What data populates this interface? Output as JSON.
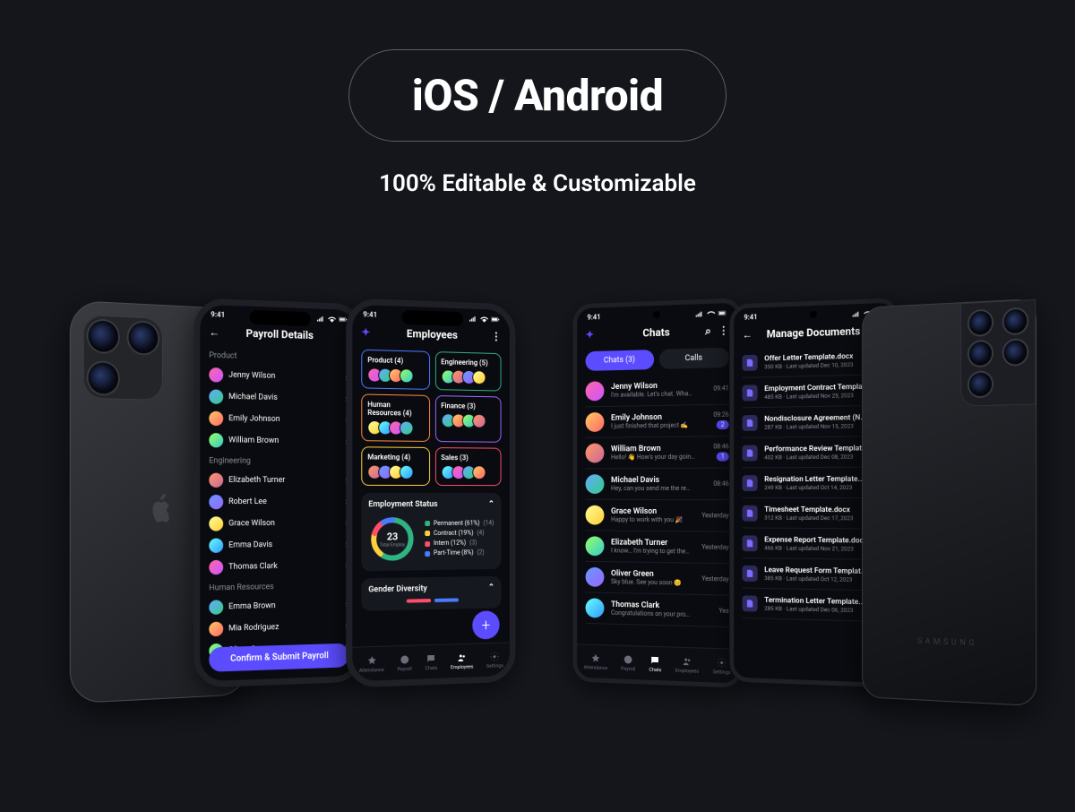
{
  "hero": {
    "title": "iOS / Android",
    "subtitle": "100% Editable & Customizable"
  },
  "status": {
    "time": "9:41"
  },
  "tabbar": [
    "Attendance",
    "Payroll",
    "Chats",
    "Employees",
    "Settings"
  ],
  "payroll": {
    "title": "Payroll Details",
    "groups": [
      {
        "name": "Product",
        "people": [
          {
            "n": "Jenny Wilson",
            "v": "$"
          },
          {
            "n": "Michael Davis",
            "v": "$"
          },
          {
            "n": "Emily Johnson",
            "v": "$"
          },
          {
            "n": "William Brown",
            "v": "$"
          }
        ]
      },
      {
        "name": "Engineering",
        "people": [
          {
            "n": "Elizabeth Turner",
            "v": "$"
          },
          {
            "n": "Robert Lee",
            "v": "$"
          },
          {
            "n": "Grace Wilson",
            "v": "$"
          },
          {
            "n": "Emma Davis",
            "v": "$"
          },
          {
            "n": "Thomas Clark",
            "v": "$"
          }
        ]
      },
      {
        "name": "Human Resources",
        "people": [
          {
            "n": "Emma Brown",
            "v": "$"
          },
          {
            "n": "Mia Rodriguez",
            "v": "$"
          },
          {
            "n": "Oliver Green",
            "v": "$"
          }
        ]
      }
    ],
    "cta": "Confirm & Submit Payroll"
  },
  "employees": {
    "title": "Employees",
    "depts": [
      {
        "n": "Product (4)",
        "c": "#4a7bff"
      },
      {
        "n": "Engineering (5)",
        "c": "#2fb380"
      },
      {
        "n": "Human Resources (4)",
        "c": "#ff8a3c"
      },
      {
        "n": "Finance (3)",
        "c": "#9b6bff"
      },
      {
        "n": "Marketing (4)",
        "c": "#ffcf3c"
      },
      {
        "n": "Sales (3)",
        "c": "#ff4d6a"
      }
    ],
    "status_panel": {
      "title": "Employment Status",
      "total": "23",
      "total_label": "Total Employ",
      "items": [
        {
          "l": "Permanent (61%)",
          "n": "(14)",
          "c": "#2fb380"
        },
        {
          "l": "Contract (19%)",
          "n": "(4)",
          "c": "#ffcf3c"
        },
        {
          "l": "Intern (12%)",
          "n": "(3)",
          "c": "#ff4d6a"
        },
        {
          "l": "Part-Time (8%)",
          "n": "(2)",
          "c": "#4a7bff"
        }
      ]
    },
    "diversity_panel": "Gender Diversity"
  },
  "chats": {
    "title": "Chats",
    "tabs": {
      "a": "Chats (3)",
      "b": "Calls"
    },
    "items": [
      {
        "n": "Jenny Wilson",
        "p": "I'm available. Let's chat. Wha…",
        "t": "09:41",
        "b": ""
      },
      {
        "n": "Emily Johnson",
        "p": "I just finished that project ✍️",
        "t": "09:26",
        "b": "2"
      },
      {
        "n": "William Brown",
        "p": "Hello! 👋 How's your day goin…",
        "t": "08:46",
        "b": "1"
      },
      {
        "n": "Michael Davis",
        "p": "Hey, can you send me the re…",
        "t": "08:46",
        "b": ""
      },
      {
        "n": "Grace Wilson",
        "p": "Happy to work with you 🎉",
        "t": "Yesterday",
        "b": ""
      },
      {
        "n": "Elizabeth Turner",
        "p": "I know… I'm trying to get the…",
        "t": "Yesterday",
        "b": ""
      },
      {
        "n": "Oliver Green",
        "p": "Sky blue. See you soon 😊",
        "t": "Yesterday",
        "b": ""
      },
      {
        "n": "Thomas Clark",
        "p": "Congratulations on your pro…",
        "t": "Yes",
        "b": ""
      }
    ]
  },
  "docs": {
    "title": "Manage Documents",
    "items": [
      {
        "n": "Offer Letter Template.docx",
        "m": "350 KB · Last updated Dec 10, 2023"
      },
      {
        "n": "Employment Contract Template…",
        "m": "485 KB · Last updated Nov 25, 2023"
      },
      {
        "n": "Nondisclosure Agreement (NDA)…",
        "m": "287 KB · Last updated Nov 15, 2023"
      },
      {
        "n": "Performance Review Template…",
        "m": "402 KB · Last updated Dec 08, 2023"
      },
      {
        "n": "Resignation Letter Template.docx",
        "m": "249 KB · Last updated Oct 14, 2023"
      },
      {
        "n": "Timesheet Template.docx",
        "m": "312 KB · Last updated Dec 17, 2023"
      },
      {
        "n": "Expense Report Template.docx",
        "m": "466 KB · Last updated Nov 21, 2023"
      },
      {
        "n": "Leave Request Form Template…",
        "m": "385 KB · Last updated Oct 12, 2023"
      },
      {
        "n": "Termination Letter Template.do…",
        "m": "285 KB · Last updated Dec 06, 2023"
      }
    ]
  }
}
